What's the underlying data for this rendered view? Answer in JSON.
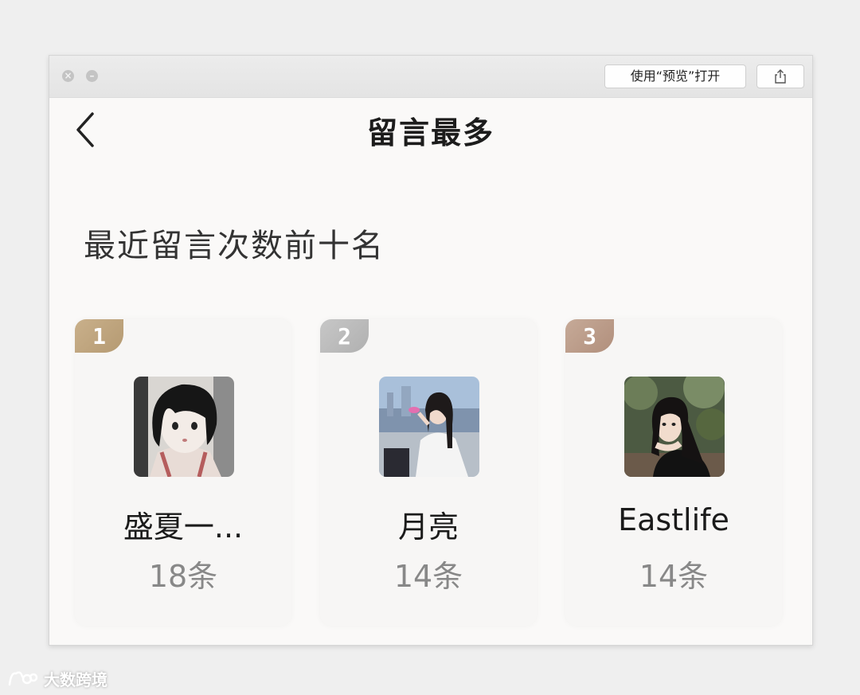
{
  "titlebar": {
    "open_preview_label": "使用“预览”打开",
    "share_icon": "share-icon"
  },
  "header": {
    "title": "留言最多"
  },
  "section": {
    "title": "最近留言次数前十名"
  },
  "ranking": [
    {
      "rank": "1",
      "name": "盛夏一...",
      "count": "18条",
      "badge_color": "#bfa47e"
    },
    {
      "rank": "2",
      "name": "月亮",
      "count": "14条",
      "badge_color": "#bcbcbc"
    },
    {
      "rank": "3",
      "name": "Eastlife",
      "count": "14条",
      "badge_color": "#bc9c89"
    }
  ],
  "watermark": {
    "text": "大数跨境"
  }
}
